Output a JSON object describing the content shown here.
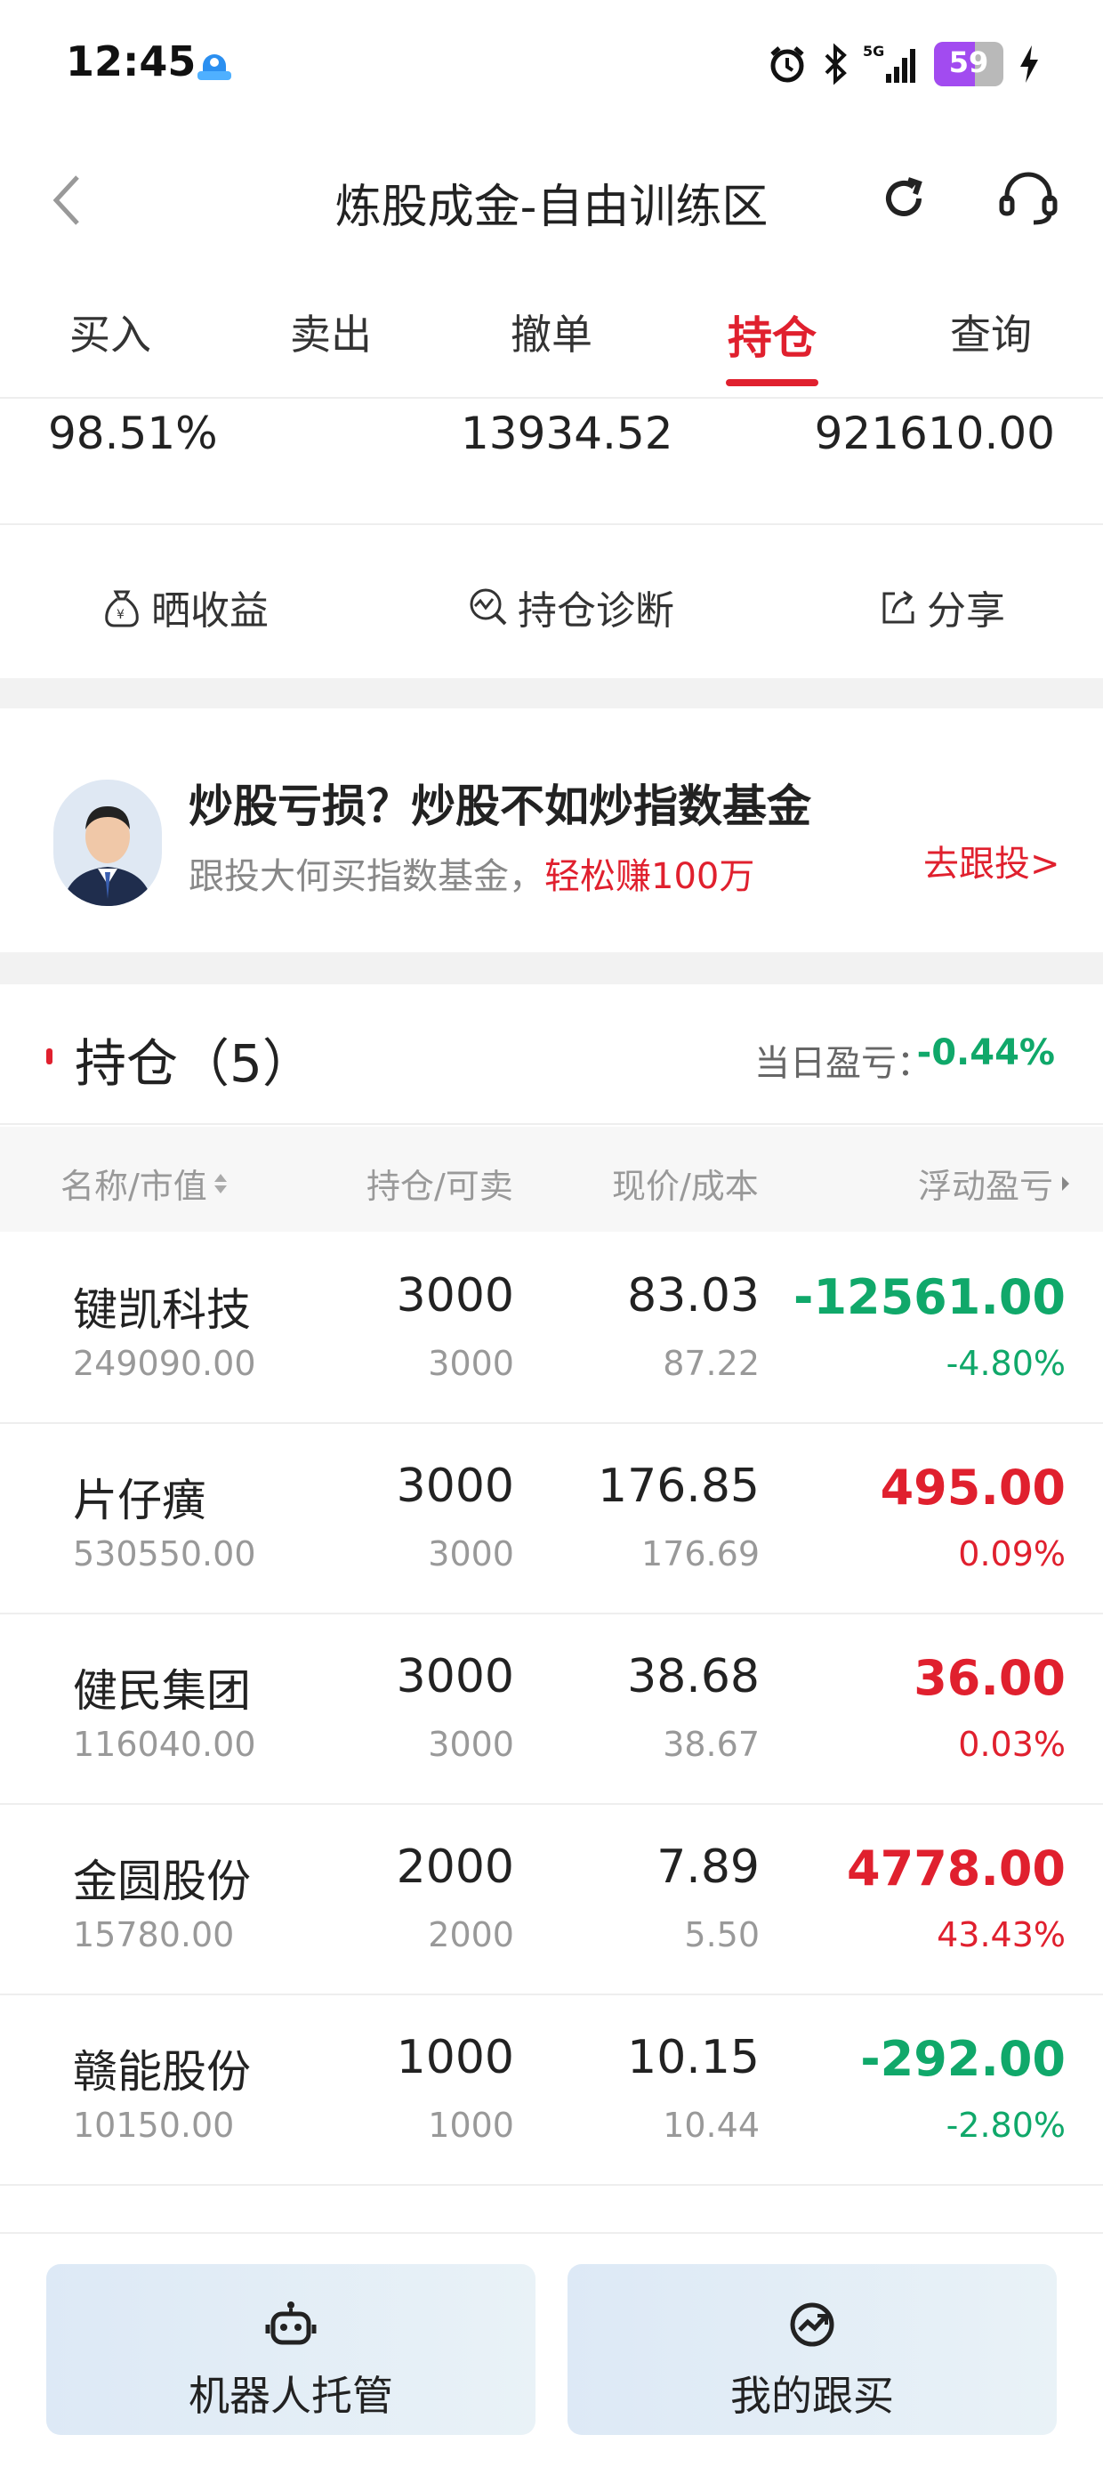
{
  "status_bar": {
    "time": "12:45",
    "battery": "59",
    "battery_level_percent": 59,
    "icons": [
      "app-icon",
      "alarm-icon",
      "bluetooth-icon",
      "signal-5g-icon",
      "battery-icon",
      "charging-icon"
    ],
    "network_label": "5G"
  },
  "header": {
    "title": "炼股成金-自由训练区",
    "icons": [
      "back-icon",
      "refresh-icon",
      "customer-service-icon"
    ]
  },
  "tabs": [
    {
      "label": "买入",
      "active": false
    },
    {
      "label": "卖出",
      "active": false
    },
    {
      "label": "撤单",
      "active": false
    },
    {
      "label": "持仓",
      "active": true
    },
    {
      "label": "查询",
      "active": false
    }
  ],
  "summary": {
    "value1": "98.51%",
    "value2": "13934.52",
    "value3": "921610.00"
  },
  "actions": [
    {
      "label": "晒收益",
      "icon": "money-bag-icon"
    },
    {
      "label": "持仓诊断",
      "icon": "diagnosis-icon"
    },
    {
      "label": "分享",
      "icon": "share-icon"
    }
  ],
  "promo": {
    "title": "炒股亏损？炒股不如炒指数基金",
    "subtitle": "跟投大何买指数基金，",
    "highlight": "轻松赚100万",
    "link": "去跟投>"
  },
  "holdings": {
    "title": "持仓（5）",
    "daily_label": "当日盈亏：",
    "daily_value": "-0.44%",
    "columns": {
      "name": "名称/市值",
      "position": "持仓/可卖",
      "price": "现价/成本",
      "pl": "浮动盈亏"
    },
    "rows": [
      {
        "name": "键凯科技",
        "market_value": "249090.00",
        "qty": "3000",
        "available": "3000",
        "price": "83.03",
        "cost": "87.22",
        "pl": "-12561.00",
        "pl_pct": "-4.80%",
        "trend": "down"
      },
      {
        "name": "片仔癀",
        "market_value": "530550.00",
        "qty": "3000",
        "available": "3000",
        "price": "176.85",
        "cost": "176.69",
        "pl": "495.00",
        "pl_pct": "0.09%",
        "trend": "up"
      },
      {
        "name": "健民集团",
        "market_value": "116040.00",
        "qty": "3000",
        "available": "3000",
        "price": "38.68",
        "cost": "38.67",
        "pl": "36.00",
        "pl_pct": "0.03%",
        "trend": "up"
      },
      {
        "name": "金圆股份",
        "market_value": "15780.00",
        "qty": "2000",
        "available": "2000",
        "price": "7.89",
        "cost": "5.50",
        "pl": "4778.00",
        "pl_pct": "43.43%",
        "trend": "up"
      },
      {
        "name": "赣能股份",
        "market_value": "10150.00",
        "qty": "1000",
        "available": "1000",
        "price": "10.15",
        "cost": "10.44",
        "pl": "-292.00",
        "pl_pct": "-2.80%",
        "trend": "down"
      }
    ]
  },
  "bottom": {
    "robot_label": "机器人托管",
    "follow_label": "我的跟买"
  },
  "colors": {
    "accent_red": "#e0202e",
    "gain_red": "#e0202e",
    "loss_green": "#10a86a"
  }
}
